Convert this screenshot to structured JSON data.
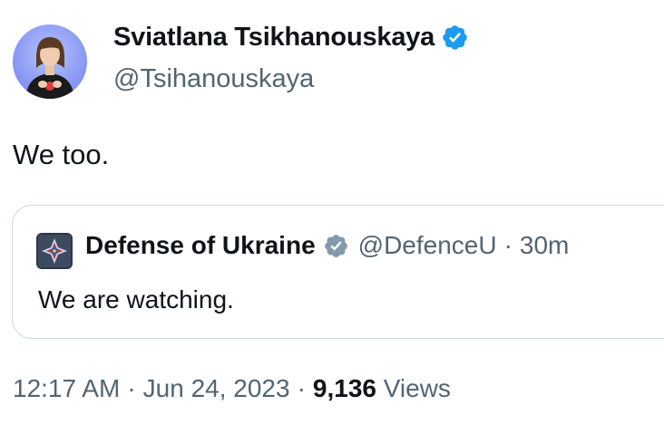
{
  "author": {
    "name": "Sviatlana Tsikhanouskaya",
    "handle": "@Tsihanouskaya",
    "verified_color": "#1d9bf0"
  },
  "tweet": {
    "text": "We too."
  },
  "quoted_tweet": {
    "name": "Defense of Ukraine",
    "handle": "@DefenceU",
    "separator": "·",
    "time": "30m",
    "text": "We are watching.",
    "verified_color": "#829aab"
  },
  "meta": {
    "time": "12:17 AM",
    "separator": "·",
    "date": "Jun 24, 2023",
    "views_count": "9,136",
    "views_label": "Views"
  },
  "colors": {
    "text_primary": "#0f1419",
    "text_secondary": "#536471",
    "border": "#cfd9de"
  }
}
